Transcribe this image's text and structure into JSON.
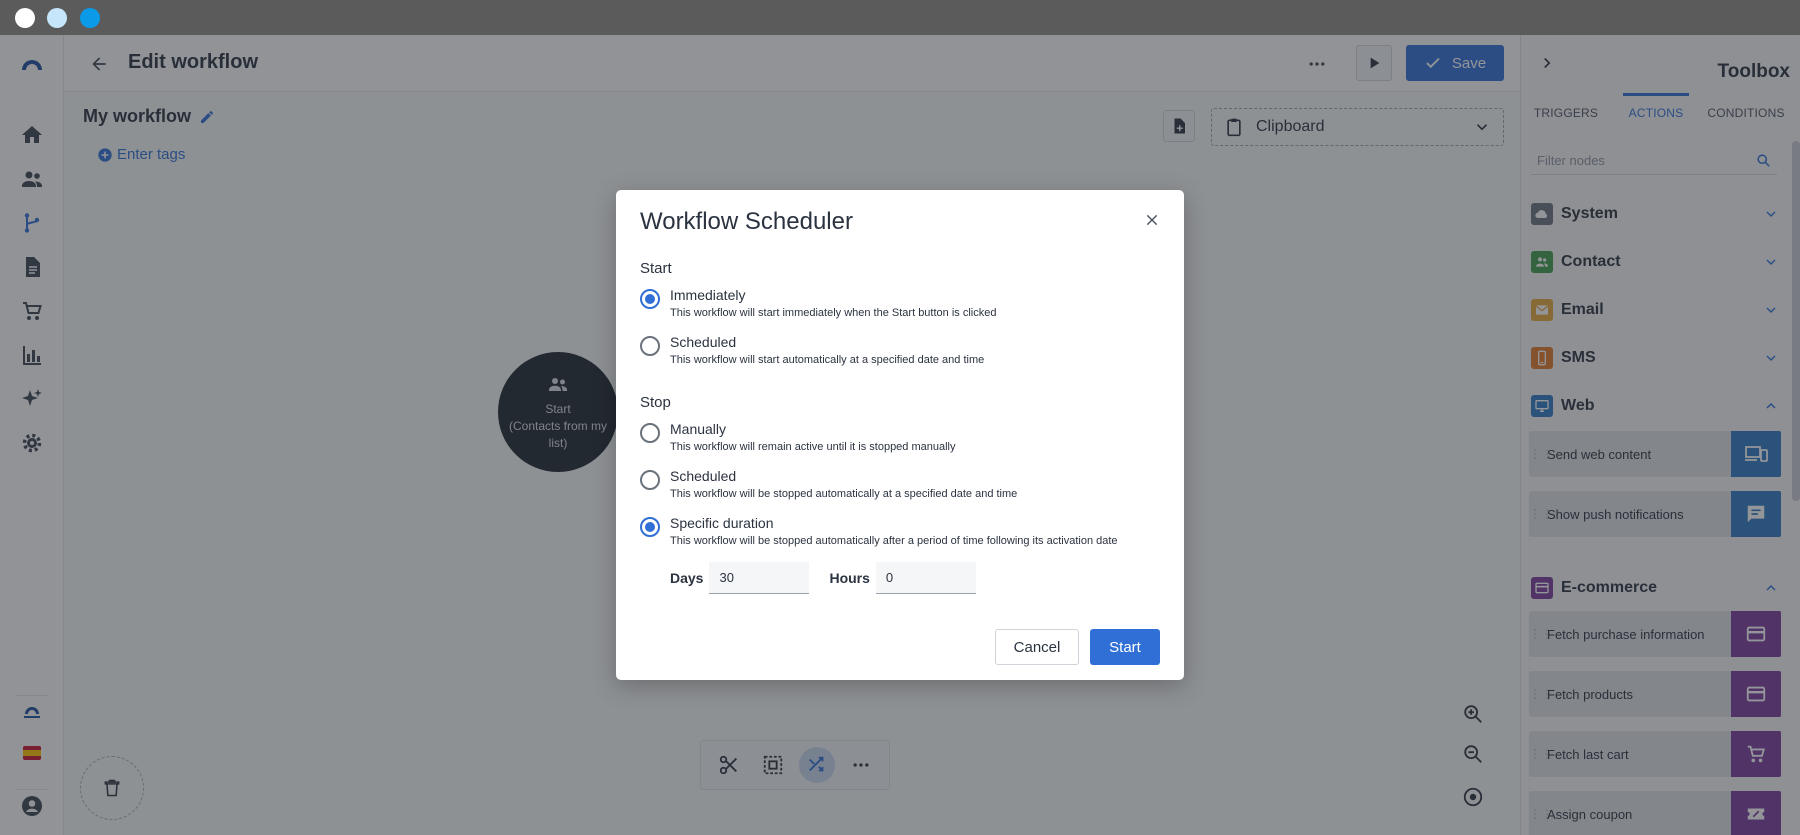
{
  "header": {
    "title": "Edit workflow",
    "save_label": "Save"
  },
  "canvas": {
    "workflow_name": "My workflow",
    "tags_label": "Enter tags",
    "clipboard_label": "Clipboard",
    "start_node": {
      "line1": "Start",
      "line2": "(Contacts from my",
      "line3": "list)"
    }
  },
  "toolbox": {
    "title": "Toolbox",
    "tabs": [
      "TRIGGERS",
      "ACTIONS",
      "CONDITIONS"
    ],
    "active_tab": "ACTIONS",
    "filter_placeholder": "Filter nodes",
    "categories": [
      {
        "label": "System",
        "color": "#6b7280",
        "expanded": false
      },
      {
        "label": "Contact",
        "color": "#3f9a4d",
        "expanded": false
      },
      {
        "label": "Email",
        "color": "#e8a93a",
        "expanded": false
      },
      {
        "label": "SMS",
        "color": "#e07b2a",
        "expanded": false
      },
      {
        "label": "Web",
        "color": "#2f78c4",
        "expanded": true
      },
      {
        "label": "E-commerce",
        "color": "#7b3b9e",
        "expanded": true
      }
    ],
    "web_nodes": [
      {
        "label": "Send web content",
        "icon": "devices-icon"
      },
      {
        "label": "Show push notifications",
        "icon": "chat-icon"
      }
    ],
    "ecommerce_nodes": [
      {
        "label": "Fetch purchase information",
        "icon": "credit-card-icon"
      },
      {
        "label": "Fetch products",
        "icon": "credit-card-icon"
      },
      {
        "label": "Fetch last cart",
        "icon": "cart-icon"
      },
      {
        "label": "Assign coupon",
        "icon": "coupon-icon"
      }
    ]
  },
  "modal": {
    "title": "Workflow Scheduler",
    "start_section": "Start",
    "start_options": [
      {
        "label": "Immediately",
        "desc": "This workflow will start immediately when the Start button is clicked",
        "selected": true
      },
      {
        "label": "Scheduled",
        "desc": "This workflow will start automatically at a specified date and time",
        "selected": false
      }
    ],
    "stop_section": "Stop",
    "stop_options": [
      {
        "label": "Manually",
        "desc": "This workflow will remain active until it is stopped manually",
        "selected": false
      },
      {
        "label": "Scheduled",
        "desc": "This workflow will be stopped automatically at a specified date and time",
        "selected": false
      },
      {
        "label": "Specific duration",
        "desc": "This workflow will be stopped automatically after a period of time following its activation date",
        "selected": true
      }
    ],
    "days_label": "Days",
    "days_value": "30",
    "hours_label": "Hours",
    "hours_value": "0",
    "cancel_label": "Cancel",
    "start_label": "Start"
  },
  "colors": {
    "accent": "#2f6fd6",
    "sidebar_logo": "#1d4f9c"
  }
}
